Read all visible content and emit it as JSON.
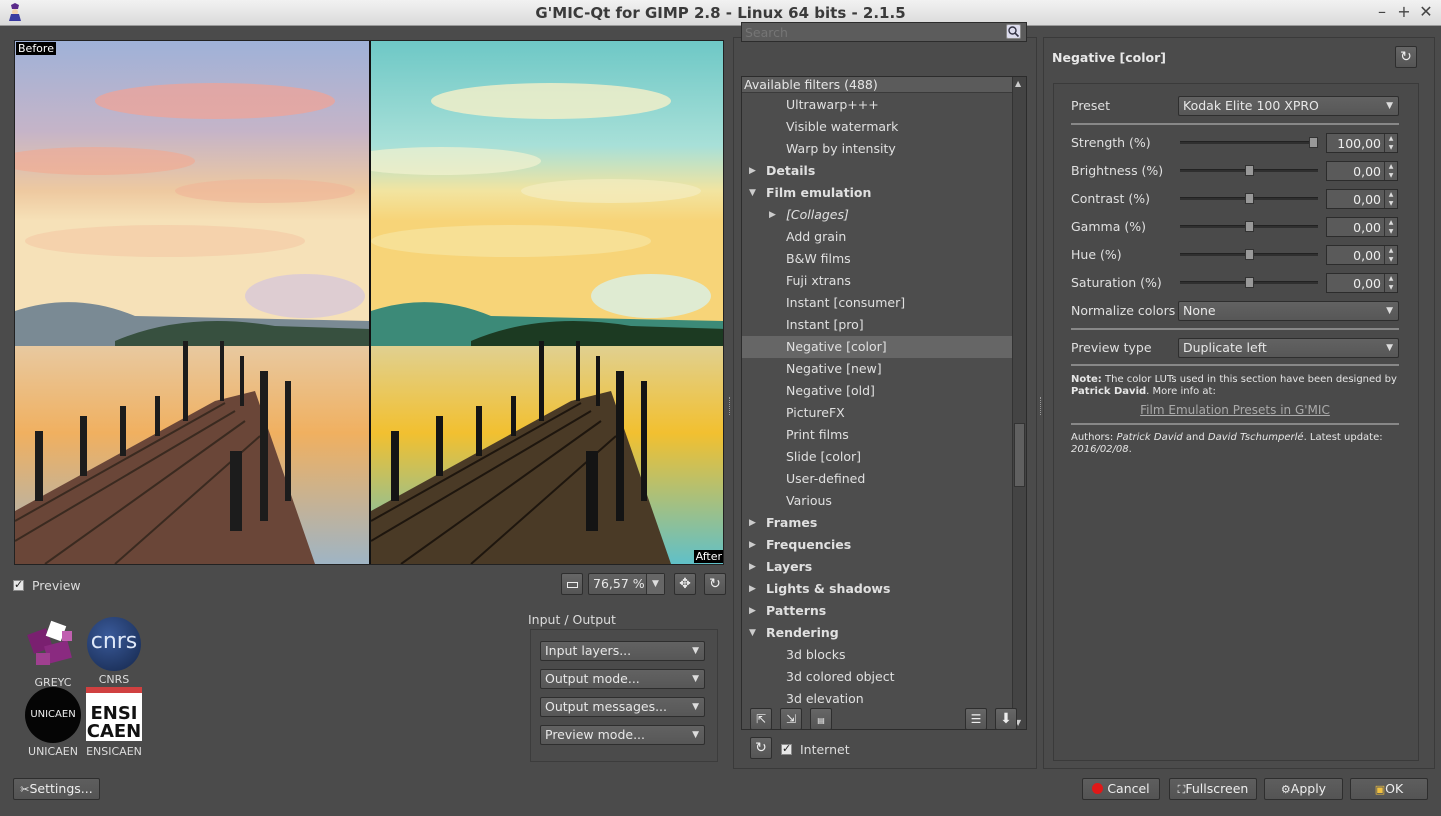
{
  "window": {
    "title": "G'MIC-Qt for GIMP 2.8 - Linux 64 bits - 2.1.5",
    "minimize": "–",
    "maximize": "+",
    "close": "✕"
  },
  "preview": {
    "before_label": "Before",
    "after_label": "After",
    "preview_checkbox_label": "Preview",
    "zoom_value": "76,57 %"
  },
  "logos": {
    "greyc": "GREYC",
    "cnrs": "CNRS",
    "cnrs_text": "cnrs",
    "unicaen": "UNICAEN",
    "unicaen_text": "UNICAEN",
    "ensicaen": "ENSICAEN",
    "ensicaen_line1": "ENSI",
    "ensicaen_line2": "CAEN"
  },
  "io": {
    "title": "Input / Output",
    "input_layers": "Input layers...",
    "output_mode": "Output mode...",
    "output_messages": "Output messages...",
    "preview_mode": "Preview mode..."
  },
  "filters": {
    "search_placeholder": "Search",
    "header": "Available filters (488)",
    "items": [
      {
        "label": "Ultrawarp+++",
        "level": 1,
        "type": "leaf"
      },
      {
        "label": "Visible watermark",
        "level": 1,
        "type": "leaf"
      },
      {
        "label": "Warp by intensity",
        "level": 1,
        "type": "leaf"
      },
      {
        "label": "Details",
        "level": 0,
        "type": "collapsed"
      },
      {
        "label": "Film emulation",
        "level": 0,
        "type": "expanded"
      },
      {
        "label": "[Collages]",
        "level": 1,
        "type": "subcollapsed"
      },
      {
        "label": "Add grain",
        "level": 1,
        "type": "leaf"
      },
      {
        "label": "B&W films",
        "level": 1,
        "type": "leaf"
      },
      {
        "label": "Fuji xtrans",
        "level": 1,
        "type": "leaf"
      },
      {
        "label": "Instant [consumer]",
        "level": 1,
        "type": "leaf"
      },
      {
        "label": "Instant [pro]",
        "level": 1,
        "type": "leaf"
      },
      {
        "label": "Negative [color]",
        "level": 1,
        "type": "leaf",
        "selected": true
      },
      {
        "label": "Negative [new]",
        "level": 1,
        "type": "leaf"
      },
      {
        "label": "Negative [old]",
        "level": 1,
        "type": "leaf"
      },
      {
        "label": "PictureFX",
        "level": 1,
        "type": "leaf"
      },
      {
        "label": "Print films",
        "level": 1,
        "type": "leaf"
      },
      {
        "label": "Slide [color]",
        "level": 1,
        "type": "leaf"
      },
      {
        "label": "User-defined",
        "level": 1,
        "type": "leaf"
      },
      {
        "label": "Various",
        "level": 1,
        "type": "leaf"
      },
      {
        "label": "Frames",
        "level": 0,
        "type": "collapsed"
      },
      {
        "label": "Frequencies",
        "level": 0,
        "type": "collapsed"
      },
      {
        "label": "Layers",
        "level": 0,
        "type": "collapsed"
      },
      {
        "label": "Lights & shadows",
        "level": 0,
        "type": "collapsed"
      },
      {
        "label": "Patterns",
        "level": 0,
        "type": "collapsed"
      },
      {
        "label": "Rendering",
        "level": 0,
        "type": "expanded"
      },
      {
        "label": "3d blocks",
        "level": 1,
        "type": "leaf"
      },
      {
        "label": "3d colored object",
        "level": 1,
        "type": "leaf"
      },
      {
        "label": "3d elevation",
        "level": 1,
        "type": "leaf"
      }
    ],
    "internet_label": "Internet"
  },
  "params": {
    "filter_name": "Negative [color]",
    "preset_label": "Preset",
    "preset_value": "Kodak Elite 100 XPRO",
    "sliders": [
      {
        "label": "Strength (%)",
        "value": "100,00",
        "level": 1.0
      },
      {
        "label": "Brightness (%)",
        "value": "0,00",
        "level": 0.5
      },
      {
        "label": "Contrast (%)",
        "value": "0,00",
        "level": 0.5
      },
      {
        "label": "Gamma (%)",
        "value": "0,00",
        "level": 0.5
      },
      {
        "label": "Hue (%)",
        "value": "0,00",
        "level": 0.5
      },
      {
        "label": "Saturation (%)",
        "value": "0,00",
        "level": 0.5
      }
    ],
    "normalize_label": "Normalize colors",
    "normalize_value": "None",
    "preview_type_label": "Preview type",
    "preview_type_value": "Duplicate left",
    "note_bold": "Note:",
    "note_text": " The color LUTs used in this section have been designed by ",
    "note_author": "Patrick David",
    "note_more": ". More info at:",
    "link": "Film Emulation Presets in G'MIC",
    "authors_prefix": "Authors: ",
    "author1": "Patrick David",
    "authors_and": " and ",
    "author2": "David Tschumperlé",
    "update_prefix": ". Latest update: ",
    "update_date": "2016/02/08",
    "update_suffix": "."
  },
  "buttons": {
    "settings": "Settings...",
    "cancel": "Cancel",
    "fullscreen": "Fullscreen",
    "apply": "Apply",
    "ok": "OK"
  }
}
